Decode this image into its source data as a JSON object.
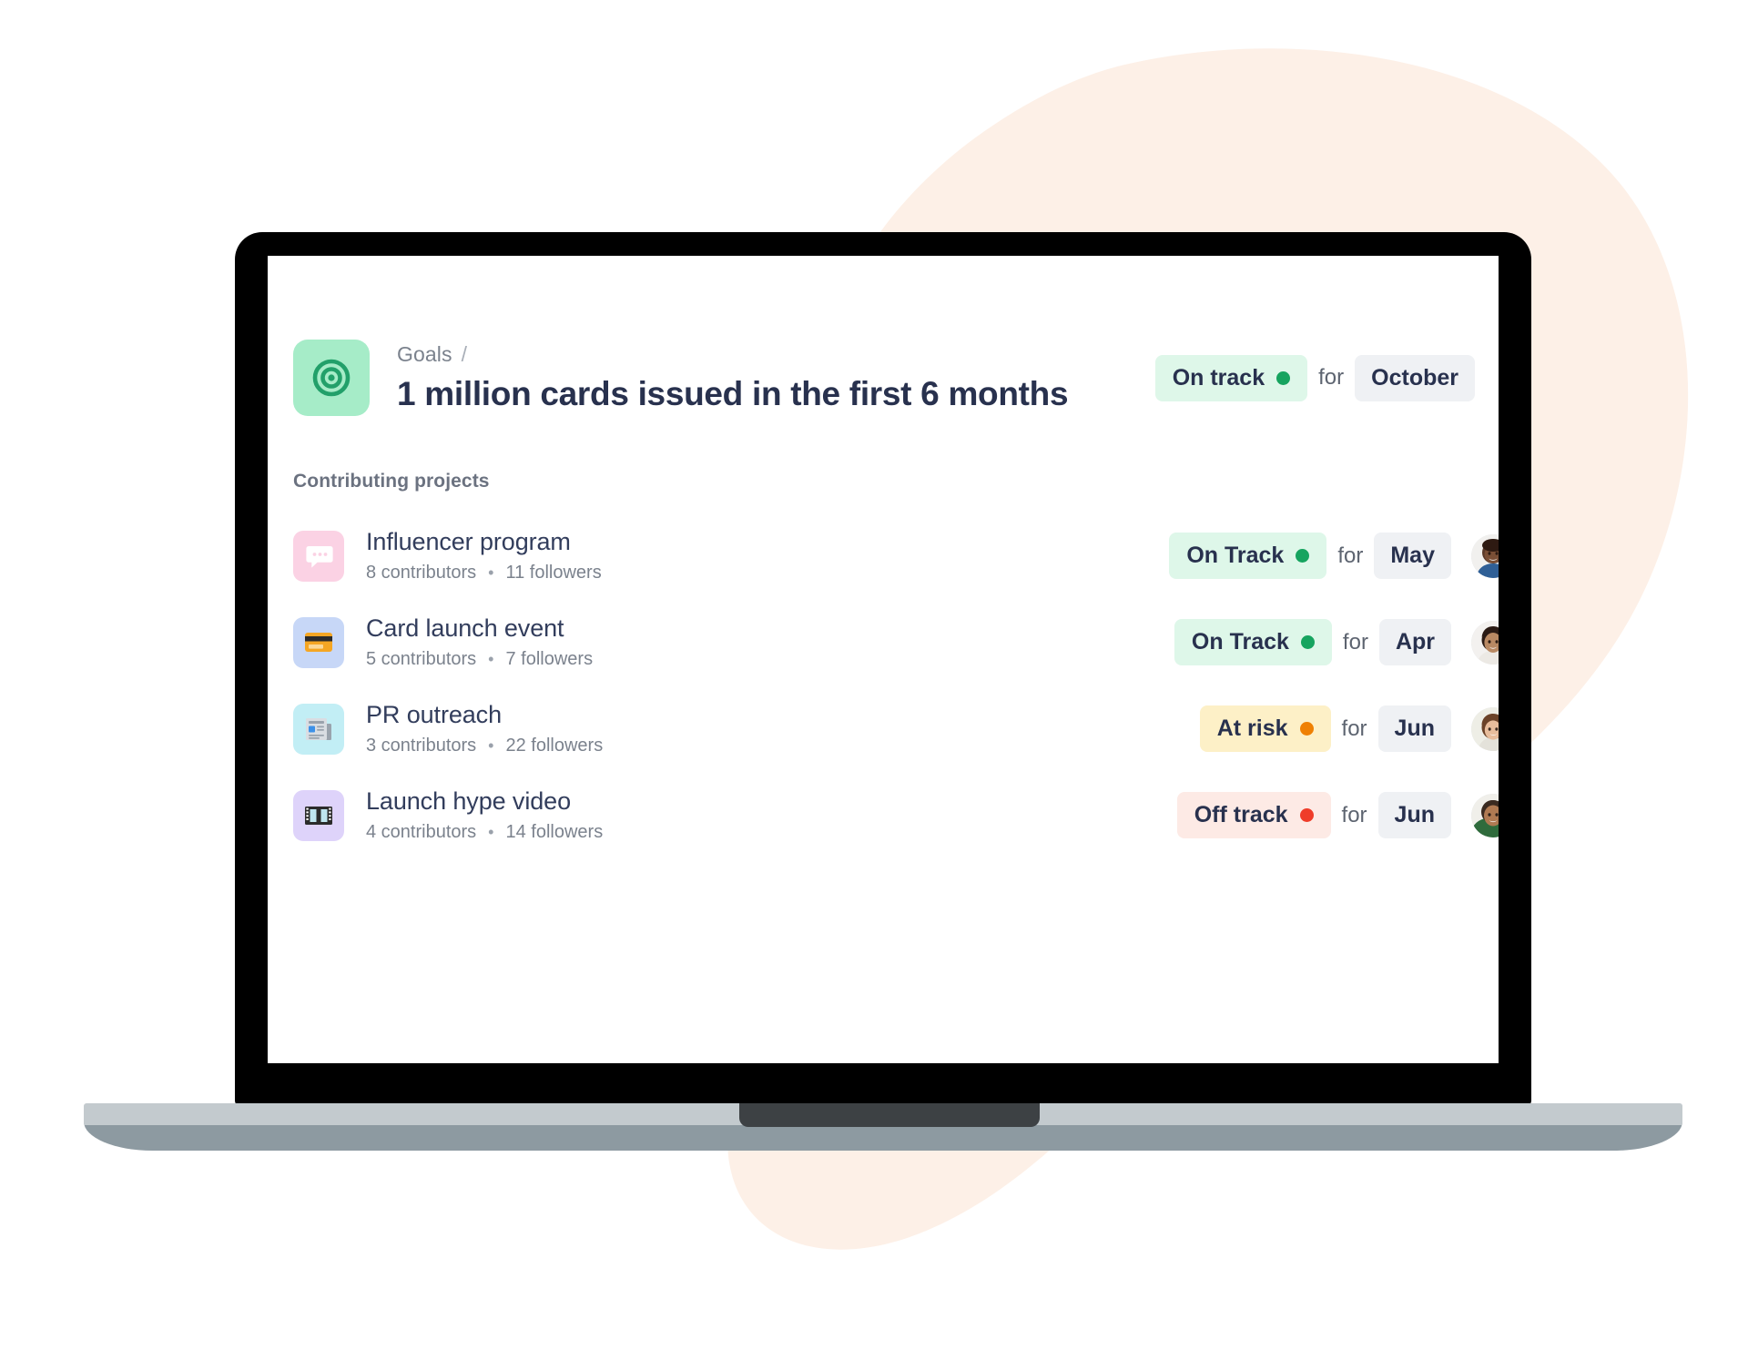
{
  "page": {
    "background_color": "#ffffff",
    "blob_color": "#fdf0e7"
  },
  "device": {
    "type": "laptop-mockup",
    "bezel_color": "#000000",
    "base_color": "#c3cace",
    "base_shadow_color": "#8d9aa1"
  },
  "header": {
    "icon_name": "goal-target-icon",
    "icon_tile_color": "#a6ecc8",
    "icon_glyph_color": "#22a06a",
    "breadcrumb": {
      "parent": "Goals",
      "separator": "/"
    },
    "title": "1 million cards issued in the first 6 months",
    "status": {
      "label": "On track",
      "dot_color": "#16a45f",
      "pill_color": "#def7e9",
      "variant": "ontrack"
    },
    "for_word": "for",
    "month": "October"
  },
  "section": {
    "label": "Contributing projects"
  },
  "projects": [
    {
      "name": "Influencer program",
      "contributors": "8 contributors",
      "separator": "•",
      "followers": "11 followers",
      "icon_name": "speech-bubble-icon",
      "icon_tile_color": "#fbd2e4",
      "status": {
        "label": "On Track",
        "variant": "ontrack",
        "dot_color": "#16a45f",
        "pill_color": "#def7e9"
      },
      "for_word": "for",
      "month": "May",
      "avatar_name": "owner-avatar"
    },
    {
      "name": "Card launch event",
      "contributors": "5 contributors",
      "separator": "•",
      "followers": "7 followers",
      "icon_name": "credit-card-icon",
      "icon_tile_color": "#c7d7f7",
      "status": {
        "label": "On Track",
        "variant": "ontrack",
        "dot_color": "#16a45f",
        "pill_color": "#def7e9"
      },
      "for_word": "for",
      "month": "Apr",
      "avatar_name": "owner-avatar"
    },
    {
      "name": "PR outreach",
      "contributors": "3 contributors",
      "separator": "•",
      "followers": "22 followers",
      "icon_name": "newspaper-icon",
      "icon_tile_color": "#c2eef5",
      "status": {
        "label": "At risk",
        "variant": "atrisk",
        "dot_color": "#ef8003",
        "pill_color": "#fdf0c7"
      },
      "for_word": "for",
      "month": "Jun",
      "avatar_name": "owner-avatar"
    },
    {
      "name": "Launch hype video",
      "contributors": "4 contributors",
      "separator": "•",
      "followers": "14 followers",
      "icon_name": "film-strip-icon",
      "icon_tile_color": "#ded3fa",
      "status": {
        "label": "Off track",
        "variant": "offtrack",
        "dot_color": "#ef3c29",
        "pill_color": "#fdeae5"
      },
      "for_word": "for",
      "month": "Jun",
      "avatar_name": "owner-avatar"
    }
  ]
}
